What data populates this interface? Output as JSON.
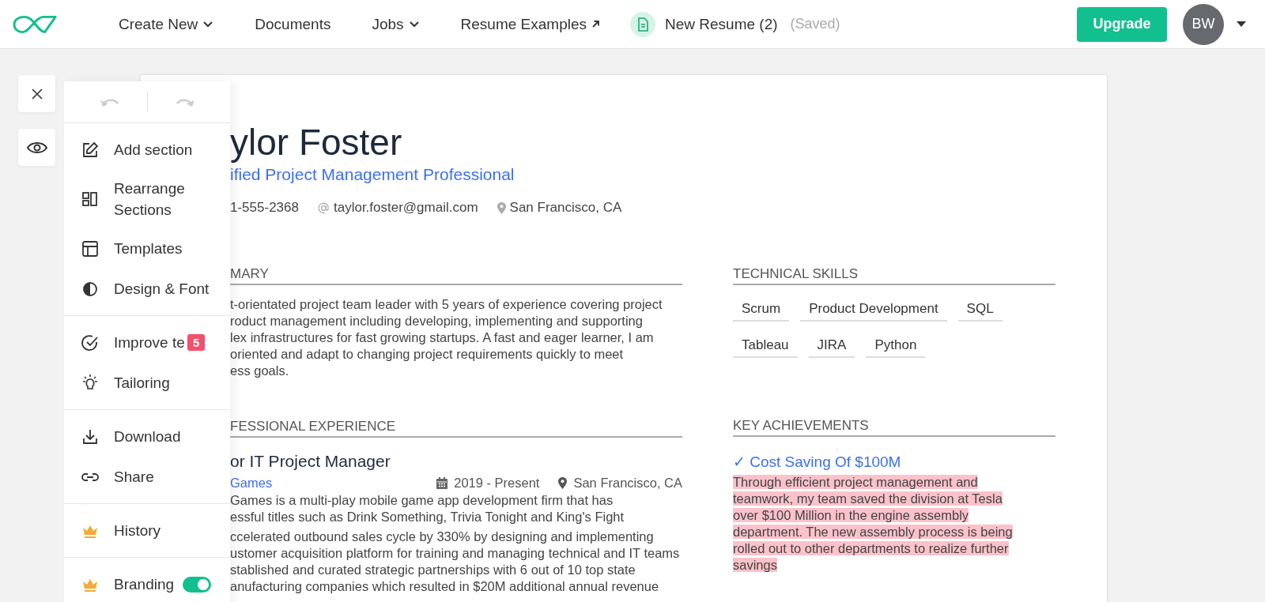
{
  "nav": {
    "items": [
      {
        "label": "Create New",
        "dropdown": true,
        "external": false
      },
      {
        "label": "Documents",
        "dropdown": false,
        "external": false
      },
      {
        "label": "Jobs",
        "dropdown": true,
        "external": false
      },
      {
        "label": "Resume Examples",
        "dropdown": false,
        "external": true
      }
    ],
    "document": {
      "title": "New Resume (2)",
      "status": "(Saved)"
    },
    "upgrade": "Upgrade",
    "avatar": "BW"
  },
  "menu": {
    "groups": [
      [
        {
          "label": "Add section"
        },
        {
          "label": "Rearrange Sections"
        },
        {
          "label": "Templates"
        },
        {
          "label": "Design & Font"
        }
      ],
      [
        {
          "label": "Improve te",
          "badge": "5"
        },
        {
          "label": "Tailoring"
        }
      ],
      [
        {
          "label": "Download"
        },
        {
          "label": "Share"
        }
      ],
      [
        {
          "label": "History"
        }
      ],
      [
        {
          "label": "Branding",
          "toggle": true,
          "on": true
        }
      ]
    ]
  },
  "resume": {
    "name": "ylor Foster",
    "headline": "ified Project Management Professional",
    "contacts": [
      {
        "kind": "phone",
        "text": "1-555-2368"
      },
      {
        "kind": "email",
        "text": "taylor.foster@gmail.com"
      },
      {
        "kind": "location",
        "text": "San Francisco, CA"
      }
    ],
    "summary": {
      "heading": "MARY",
      "lines": [
        "t-orientated project team leader with 5 years of experience covering project",
        "roduct management including developing, implementing and supporting",
        "lex infrastructures for fast growing startups. A fast and eager learner, I am",
        "oriented and adapt to changing project requirements quickly to meet",
        "ess goals."
      ]
    },
    "experience": {
      "heading": "FESSIONAL EXPERIENCE",
      "title": "or IT Project Manager",
      "company": "Games",
      "dates": "2019 - Present",
      "location": "San Francisco, CA",
      "description": [
        "Games is a multi-play mobile game app development firm that has",
        "essful titles such as Drink Something, Trivia Tonight and King's Fight"
      ],
      "bullets": [
        "ccelerated outbound sales cycle by 330% by designing and implementing",
        "ustomer acquisition platform for training and managing technical and IT teams",
        "stablished and curated strategic partnerships with 6 out of 10 top state",
        "anufacturing companies which resulted in $20M additional annual revenue"
      ]
    },
    "skills": {
      "heading": "TECHNICAL SKILLS",
      "items": [
        "Scrum",
        "Product Development",
        "SQL",
        "Tableau",
        "JIRA",
        "Python"
      ]
    },
    "achievements": {
      "heading": "KEY ACHIEVEMENTS",
      "items": [
        {
          "title": "✓ Cost Saving Of $100M",
          "text": "Through efficient project management and teamwork, my team saved the division at Tesla over $100 Million in the engine assembly department. The new assembly process is being rolled out to other departments to realize further savings",
          "highlighted": true
        }
      ]
    }
  }
}
